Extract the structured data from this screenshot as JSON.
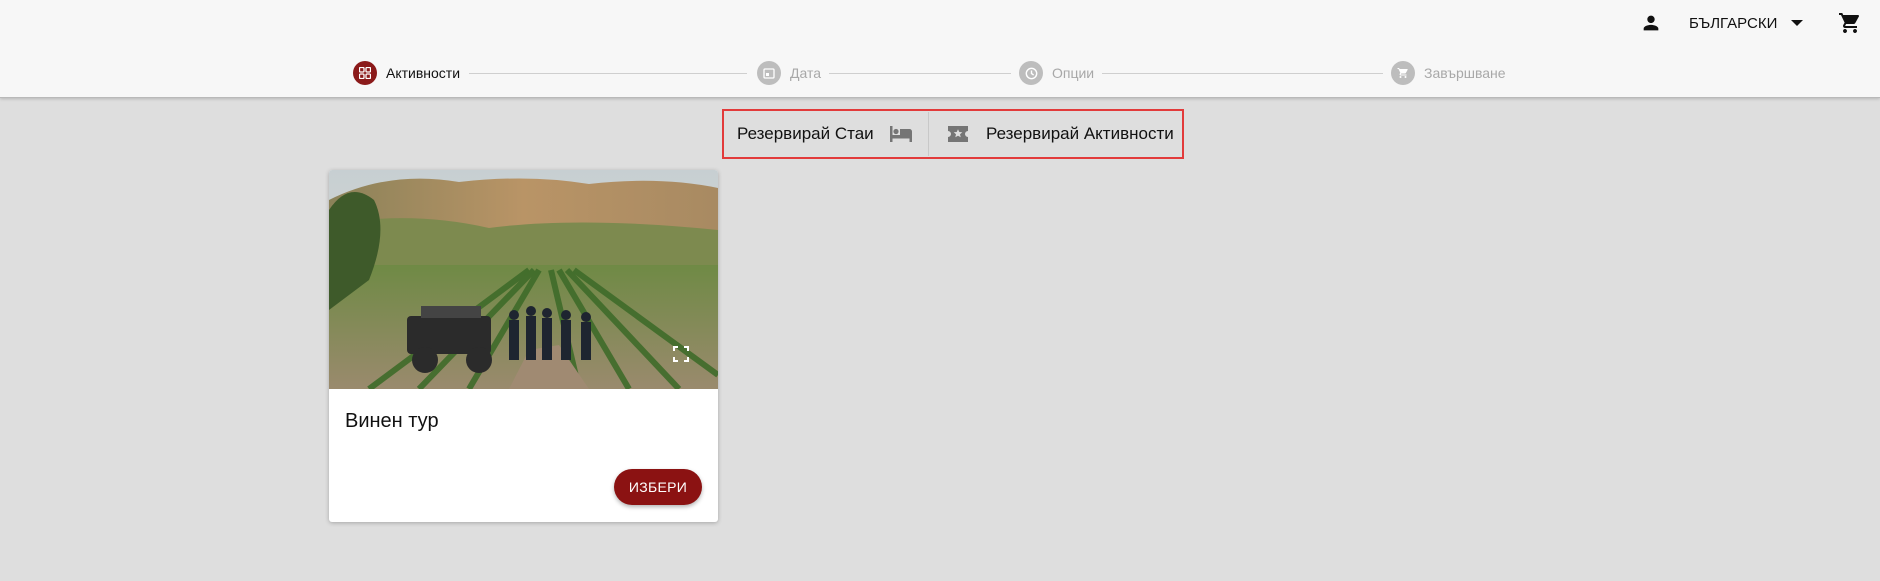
{
  "header": {
    "account_icon": "person-icon",
    "language": {
      "selected": "БЪЛГАРСКИ",
      "icon": "caret-down-icon"
    },
    "cart_icon": "shopping-cart-icon"
  },
  "stepper": {
    "steps": [
      {
        "label": "Активности",
        "icon": "grid-icon",
        "active": true
      },
      {
        "label": "Дата",
        "icon": "calendar-icon",
        "active": false
      },
      {
        "label": "Опции",
        "icon": "clock-icon",
        "active": false
      },
      {
        "label": "Завършване",
        "icon": "cart-icon",
        "active": false
      }
    ]
  },
  "booking_toggle": {
    "rooms_label": "Резервирай Стаи",
    "rooms_icon": "bed-icon",
    "activities_label": "Резервирай Активности",
    "activities_icon": "ticket-star-icon"
  },
  "activities": [
    {
      "title": "Винен тур",
      "select_label": "ИЗБЕРИ",
      "image_icon": "vineyard-photo",
      "expand_icon": "fullscreen-icon"
    }
  ],
  "colors": {
    "accent": "#8b1a1a",
    "highlight_border": "#e23b3b",
    "page_background": "#dedede",
    "header_background": "#f7f7f7"
  }
}
